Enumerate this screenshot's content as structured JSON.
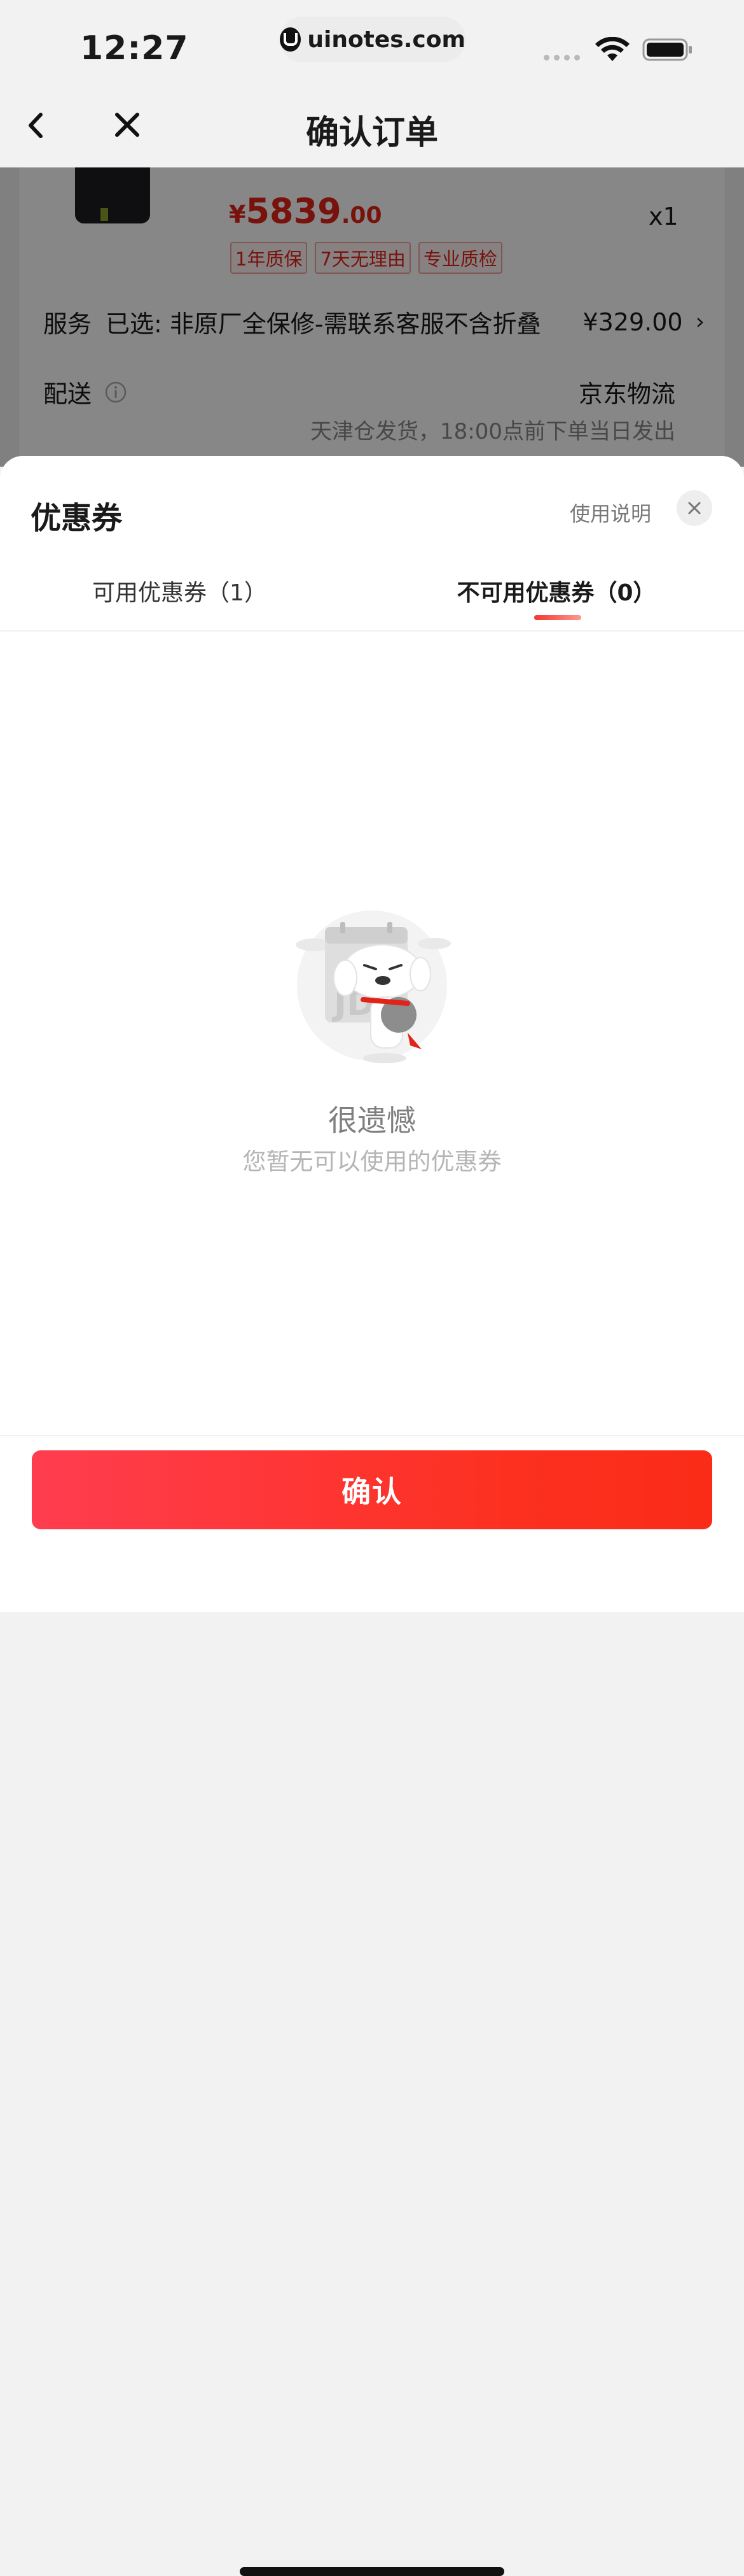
{
  "status_bar": {
    "time": "12:27",
    "url": "uinotes.com"
  },
  "nav": {
    "title": "确认订单"
  },
  "order": {
    "price_symbol": "¥",
    "price_int": "5839",
    "price_dec": ".00",
    "quantity": "x1",
    "tags": [
      "1年质保",
      "7天无理由",
      "专业质检"
    ],
    "service_label": "服务",
    "service_value": "已选: 非原厂全保修-需联系客服不含折叠",
    "service_price": "¥329.00",
    "delivery_label": "配送",
    "delivery_value": "京东物流",
    "delivery_note": "天津仓发货，18:00点前下单当日发出"
  },
  "sheet": {
    "title": "优惠券",
    "help_link": "使用说明",
    "tabs": [
      {
        "label": "可用优惠券（1）"
      },
      {
        "label": "不可用优惠券（0）"
      }
    ],
    "empty_title": "很遗憾",
    "empty_subtitle": "您暂无可以使用的优惠券",
    "confirm_label": "确认"
  },
  "colors": {
    "accent": "#e2231a",
    "button": "#fd3020"
  },
  "icons": [
    "back-icon",
    "close-icon",
    "wifi-icon",
    "battery-icon",
    "info-icon",
    "chevron-right-icon"
  ]
}
